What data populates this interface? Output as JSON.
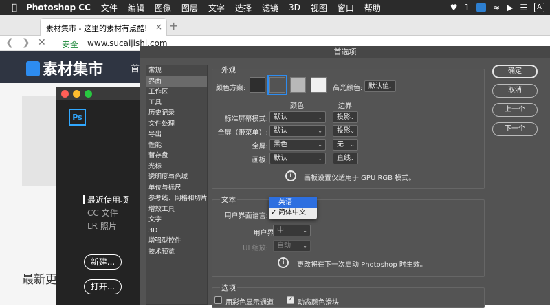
{
  "menubar": {
    "app_name": "Photoshop CC",
    "items": [
      "文件",
      "编辑",
      "图像",
      "图层",
      "文字",
      "选择",
      "滤镜",
      "3D",
      "视图",
      "窗口",
      "帮助"
    ],
    "status": {
      "notification_count": "1",
      "input_indicator": "A"
    }
  },
  "browser": {
    "tab_title": "素材集市 - 这里的素材有点酷!",
    "secure_label": "安全",
    "url": "www.sucaijishi.com"
  },
  "site": {
    "logo_text": "素材集市",
    "nav_text": "首页",
    "latest_heading": "最新更"
  },
  "ps_start": {
    "logo": "Ps",
    "nav": [
      "最近使用项",
      "CC 文件",
      "LR 照片"
    ],
    "new_button": "新建...",
    "open_button": "打开..."
  },
  "prefs": {
    "title": "首选项",
    "categories": [
      "常规",
      "界面",
      "工作区",
      "工具",
      "历史记录",
      "文件处理",
      "导出",
      "性能",
      "暂存盘",
      "光标",
      "透明度与色域",
      "单位与标尺",
      "参考线、网格和切片",
      "增效工具",
      "文字",
      "3D",
      "增强型控件",
      "技术预览"
    ],
    "selected_category_index": 1,
    "appearance": {
      "title": "外观",
      "color_scheme_label": "颜色方案:",
      "swatch_colors": [
        "#2e2e2e",
        "#535353",
        "#b8b8b8",
        "#f0f0f0"
      ],
      "selected_swatch_index": 1,
      "highlight_label": "高光颜色:",
      "highlight_value": "默认值",
      "col_color": "颜色",
      "col_border": "边界",
      "rows": [
        {
          "label": "标准屏幕模式:",
          "color": "默认",
          "border": "投影"
        },
        {
          "label": "全屏（带菜单）:",
          "color": "默认",
          "border": "投影"
        },
        {
          "label": "全屏:",
          "color": "黑色",
          "border": "无"
        },
        {
          "label": "画板:",
          "color": "默认",
          "border": "直线"
        }
      ],
      "note": "画板设置仅适用于 GPU RGB 模式。"
    },
    "text": {
      "title": "文本",
      "ui_language_label": "用户界面语言:",
      "language_options": [
        "英语",
        "简体中文"
      ],
      "language_selected": "简体中文",
      "language_highlighted": "英语",
      "font_size_label": "用户界面字体大小:",
      "font_size_value": "中",
      "ui_scale_label": "UI 缩放:",
      "ui_scale_value": "自动",
      "note": "更改将在下一次启动 Photoshop 时生效。"
    },
    "options": {
      "title": "选项",
      "use_color_channels": {
        "label": "用彩色显示通道",
        "checked": false
      },
      "dynamic_sliders": {
        "label": "动态颜色滑块",
        "checked": true
      }
    },
    "buttons": {
      "ok": "确定",
      "cancel": "取消",
      "prev": "上一个",
      "next": "下一个"
    }
  }
}
